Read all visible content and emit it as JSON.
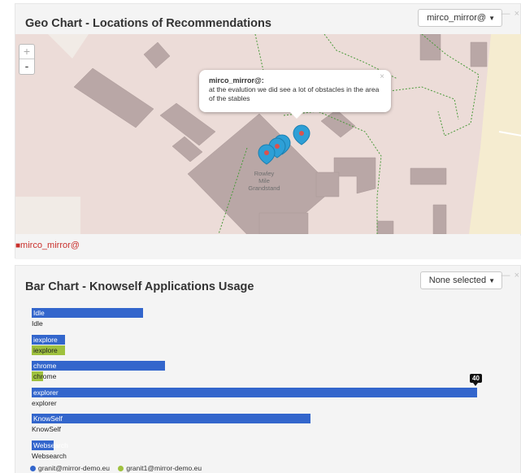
{
  "geo": {
    "title": "Geo Chart - Locations of Recommendations",
    "dropdown_label": "mirco_mirror@",
    "window_controls": "— ×",
    "zoom_in": "+",
    "zoom_out": "-",
    "popup": {
      "title": "mirco_mirror@:",
      "text": "at the evalution we did see a lot of obstacles in the area of the stables",
      "close": "×"
    },
    "map_label": [
      "Rowley",
      "Mile",
      "Grandstand"
    ],
    "footer_user": "mirco_mirror@",
    "colors": {
      "map_background": "#ecdcd8",
      "building": "#b9a7a6",
      "marker": "#2e9fd6",
      "footer_text": "#c9302c"
    }
  },
  "bar": {
    "title": "Bar Chart - Knowself Applications Usage",
    "dropdown_label": "None selected",
    "window_controls": "— ×",
    "legend": [
      {
        "name": "granit@mirror-demo.eu",
        "color": "#3366cc"
      },
      {
        "name": "granit1@mirror-demo.eu",
        "color": "#9fc13e"
      }
    ]
  },
  "chart_data": {
    "type": "bar",
    "orientation": "horizontal",
    "title": "Bar Chart - Knowself Applications Usage",
    "categories": [
      "Idle",
      "iexplore",
      "chrome",
      "explorer",
      "KnowSelf",
      "Websearch"
    ],
    "series": [
      {
        "name": "granit@mirror-demo.eu",
        "color": "#3366cc",
        "values": [
          10,
          3,
          12,
          40,
          25,
          2
        ]
      },
      {
        "name": "granit1@mirror-demo.eu",
        "color": "#9fc13e",
        "values": [
          0,
          3,
          1,
          0,
          0,
          0
        ]
      }
    ],
    "data_labels": [
      {
        "category": "explorer",
        "series": "granit@mirror-demo.eu",
        "text": "40"
      }
    ],
    "xlim": [
      0,
      40
    ],
    "grid": false,
    "legend_position": "bottom-left"
  }
}
